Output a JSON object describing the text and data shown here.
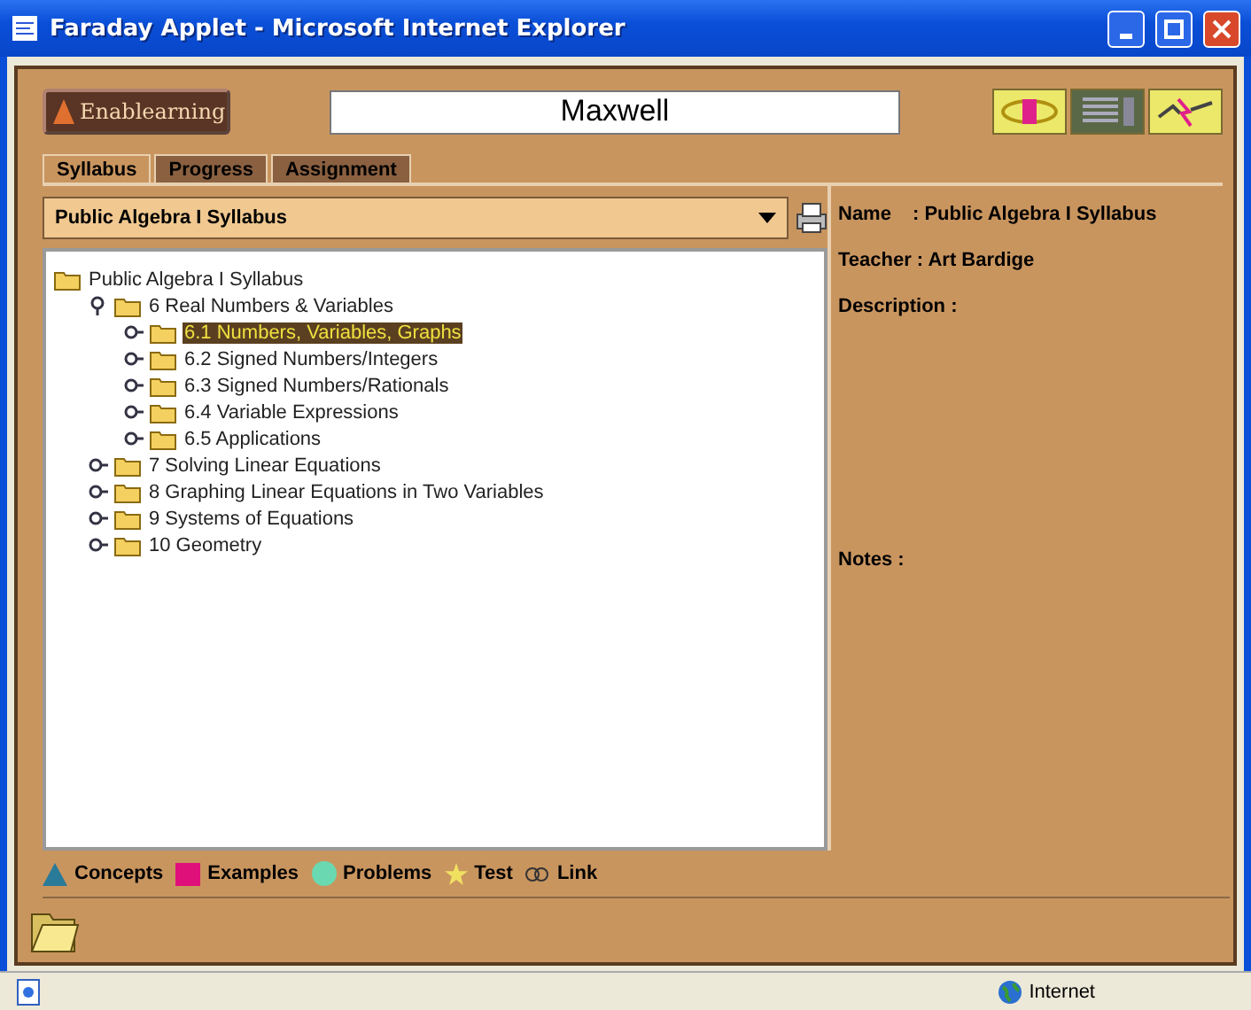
{
  "window": {
    "title": "Faraday Applet - Microsoft Internet Explorer"
  },
  "header": {
    "logo": "Enablearning",
    "user": "Maxwell"
  },
  "tabs": [
    {
      "label": "Syllabus",
      "selected": true
    },
    {
      "label": "Progress",
      "selected": false
    },
    {
      "label": "Assignment",
      "selected": false
    }
  ],
  "syllabus_select": {
    "value": "Public Algebra I Syllabus"
  },
  "tree": {
    "label": "Public Algebra I Syllabus",
    "selected": false,
    "children": [
      {
        "label": "6 Real Numbers & Variables",
        "expanded": true,
        "selected": false,
        "children": [
          {
            "label": "6.1 Numbers, Variables, Graphs",
            "expanded": false,
            "selected": true
          },
          {
            "label": "6.2 Signed Numbers/Integers",
            "expanded": false,
            "selected": false
          },
          {
            "label": "6.3 Signed Numbers/Rationals",
            "expanded": false,
            "selected": false
          },
          {
            "label": "6.4 Variable Expressions",
            "expanded": false,
            "selected": false
          },
          {
            "label": "6.5 Applications",
            "expanded": false,
            "selected": false
          }
        ]
      },
      {
        "label": "7 Solving Linear Equations",
        "expanded": false,
        "selected": false
      },
      {
        "label": "8 Graphing Linear Equations in Two Variables",
        "expanded": false,
        "selected": false
      },
      {
        "label": "9 Systems of Equations",
        "expanded": false,
        "selected": false
      },
      {
        "label": "10 Geometry",
        "expanded": false,
        "selected": false
      }
    ]
  },
  "details": {
    "name_label": "Name",
    "name_value": ": Public Algebra I Syllabus",
    "teacher": "Teacher : Art Bardige",
    "description": "Description :",
    "notes": "Notes :"
  },
  "legend": [
    {
      "kind": "concept",
      "label": "Concepts"
    },
    {
      "kind": "example",
      "label": "Examples"
    },
    {
      "kind": "problem",
      "label": "Problems"
    },
    {
      "kind": "test",
      "label": "Test"
    },
    {
      "kind": "link",
      "label": "Link"
    }
  ],
  "status_bar": {
    "zone": "Internet"
  }
}
